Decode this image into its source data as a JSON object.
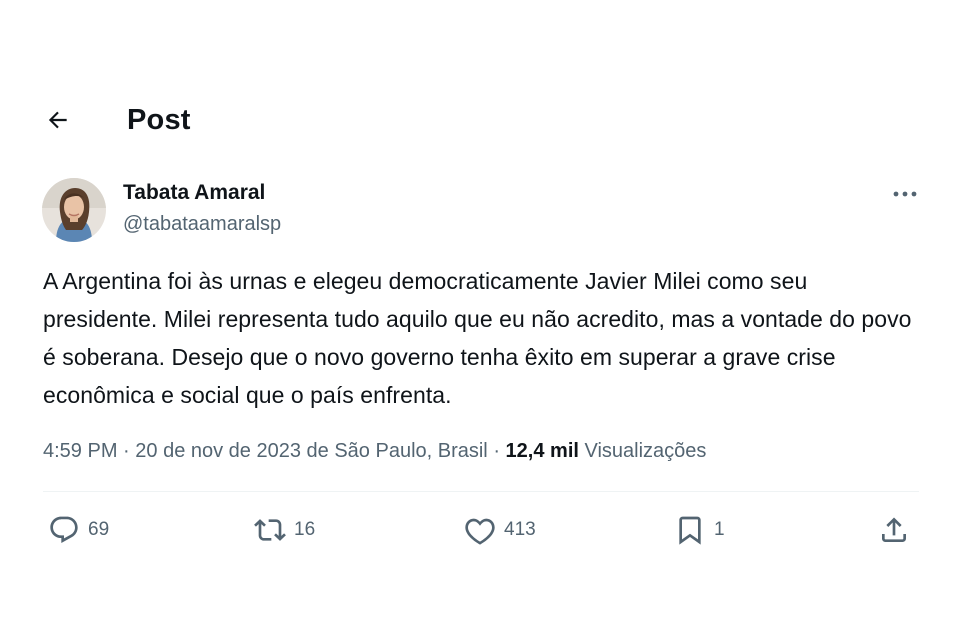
{
  "header": {
    "title": "Post"
  },
  "author": {
    "display_name": "Tabata Amaral",
    "handle": "@tabataamaralsp"
  },
  "tweet": {
    "text": "A Argentina foi às urnas e elegeu democraticamente Javier Milei como seu presidente. Milei representa tudo aquilo que eu não acredito, mas a vontade do povo é soberana. Desejo que o novo governo tenha êxito em superar a grave crise econômica e social que o país enfrenta.",
    "time": "4:59 PM",
    "date": "20 de nov de 2023",
    "location": "de São Paulo, Brasil",
    "views_count": "12,4 mil",
    "views_label": "Visualizações"
  },
  "actions": {
    "replies": "69",
    "reposts": "16",
    "likes": "413",
    "bookmarks": "1"
  },
  "icons": {
    "back": "arrow-left-icon",
    "more": "more-horizontal-icon",
    "reply": "reply-icon",
    "repost": "repost-icon",
    "like": "heart-icon",
    "bookmark": "bookmark-icon",
    "share": "share-icon"
  },
  "colors": {
    "text": "#0f1419",
    "secondary": "#536471",
    "divider": "#eff3f4"
  }
}
